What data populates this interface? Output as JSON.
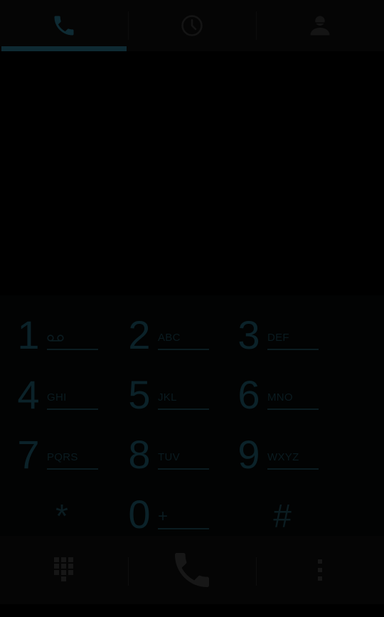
{
  "tabs": [
    {
      "name": "dialpad",
      "icon": "phone-icon",
      "selected": true
    },
    {
      "name": "call-log",
      "icon": "clock-icon",
      "selected": false
    },
    {
      "name": "contacts",
      "icon": "person-icon",
      "selected": false
    }
  ],
  "digits": {
    "value": ""
  },
  "keypad": {
    "keys": [
      {
        "digit": "1",
        "letters": ""
      },
      {
        "digit": "2",
        "letters": "ABC"
      },
      {
        "digit": "3",
        "letters": "DEF"
      },
      {
        "digit": "4",
        "letters": "GHI"
      },
      {
        "digit": "5",
        "letters": "JKL"
      },
      {
        "digit": "6",
        "letters": "MNO"
      },
      {
        "digit": "7",
        "letters": "PQRS"
      },
      {
        "digit": "8",
        "letters": "TUV"
      },
      {
        "digit": "9",
        "letters": "WXYZ"
      },
      {
        "digit": "*",
        "letters": ""
      },
      {
        "digit": "0",
        "letters": "+"
      },
      {
        "digit": "#",
        "letters": ""
      }
    ]
  },
  "actions": {
    "dialpad_toggle_icon": "dialpad-grid-icon",
    "call_icon": "phone-icon",
    "overflow_icon": "more-vertical-icon"
  },
  "colors": {
    "background": "#000000",
    "accent_dim": "#0e2a33",
    "key_text": "#0b2229"
  }
}
